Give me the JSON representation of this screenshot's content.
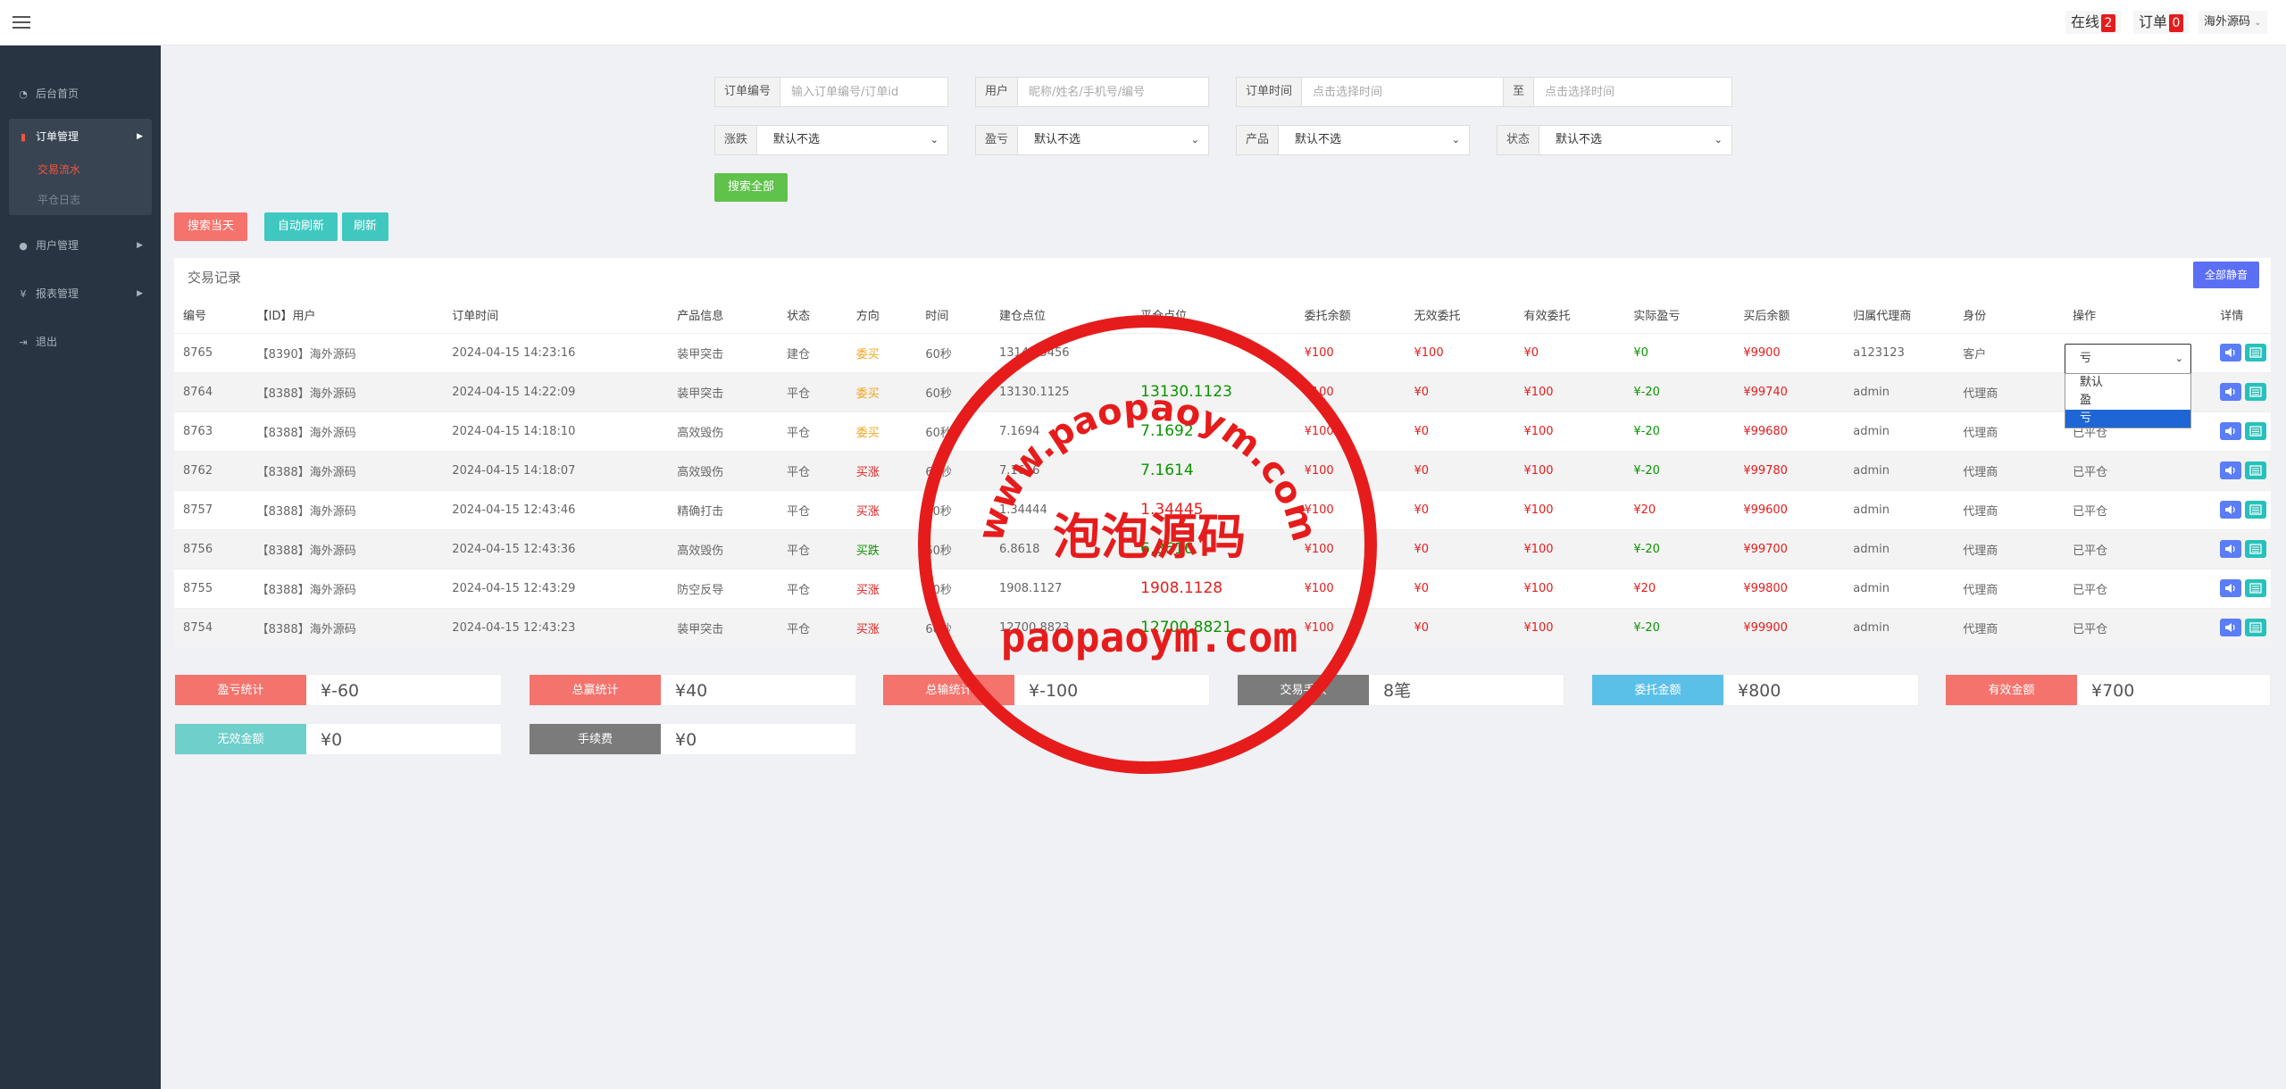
{
  "topbar": {
    "online_label": "在线",
    "online_count": "2",
    "orders_label": "订单",
    "orders_count": "0",
    "user_name": "海外源码",
    "user_caret": "⌄"
  },
  "sidebar": {
    "items": [
      {
        "label": "后台首页",
        "icon": "dashboard-icon"
      },
      {
        "label": "订单管理",
        "icon": "order-icon"
      },
      {
        "label": "用户管理",
        "icon": "user-icon"
      },
      {
        "label": "报表管理",
        "icon": "yen-icon"
      },
      {
        "label": "退出",
        "icon": "logout-icon"
      }
    ],
    "subitems": [
      {
        "label": "交易流水",
        "active": true
      },
      {
        "label": "平仓日志",
        "active": false
      }
    ]
  },
  "filters": {
    "order_no_label": "订单编号",
    "order_no_placeholder": "输入订单编号/订单id",
    "user_label": "用户",
    "user_placeholder": "昵称/姓名/手机号/编号",
    "time_label": "订单时间",
    "time_placeholder": "点击选择时间",
    "to_label": "至",
    "to_placeholder": "点击选择时间",
    "rise_label": "涨跌",
    "rise_value": "默认不选",
    "pnl_label": "盈亏",
    "pnl_value": "默认不选",
    "product_label": "产品",
    "product_value": "默认不选",
    "status_label": "状态",
    "status_value": "默认不选",
    "search_all": "搜索全部"
  },
  "actions": {
    "search_today": "搜索当天",
    "auto_refresh": "自动刷新",
    "refresh": "刷新",
    "mute_all": "全部静音"
  },
  "panel_title": "交易记录",
  "table": {
    "headers": [
      "编号",
      "【ID】用户",
      "订单时间",
      "产品信息",
      "状态",
      "方向",
      "时间",
      "建仓点位",
      "平仓点位",
      "委托余额",
      "无效委托",
      "有效委托",
      "实际盈亏",
      "买后余额",
      "归属代理商",
      "身份",
      "操作",
      "详情"
    ],
    "rows": [
      {
        "id": "8765",
        "user": "【8390】海外源码",
        "time": "2024-04-15 14:23:16",
        "product": "装甲突击",
        "status": "建仓",
        "dir": "委买",
        "dur": "60秒",
        "open": "13146.5456",
        "close": "",
        "amount": "¥100",
        "invalid": "¥100",
        "valid": "¥0",
        "pnl": "¥0",
        "balance": "¥9900",
        "agent": "a123123",
        "role": "客户",
        "op": ""
      },
      {
        "id": "8764",
        "user": "【8388】海外源码",
        "time": "2024-04-15 14:22:09",
        "product": "装甲突击",
        "status": "平仓",
        "dir": "委买",
        "dur": "60秒",
        "open": "13130.1125",
        "close": "13130.1123",
        "amount": "¥100",
        "invalid": "¥0",
        "valid": "¥100",
        "pnl": "¥-20",
        "balance": "¥99740",
        "agent": "admin",
        "role": "代理商",
        "op": ""
      },
      {
        "id": "8763",
        "user": "【8388】海外源码",
        "time": "2024-04-15 14:18:10",
        "product": "高效毁伤",
        "status": "平仓",
        "dir": "委买",
        "dur": "60秒",
        "open": "7.1694",
        "close": "7.1692",
        "amount": "¥100",
        "invalid": "¥0",
        "valid": "¥100",
        "pnl": "¥-20",
        "balance": "¥99680",
        "agent": "admin",
        "role": "代理商",
        "op": "已平仓"
      },
      {
        "id": "8762",
        "user": "【8388】海外源码",
        "time": "2024-04-15 14:18:07",
        "product": "高效毁伤",
        "status": "平仓",
        "dir": "买涨",
        "dur": "60秒",
        "open": "7.1616",
        "close": "7.1614",
        "amount": "¥100",
        "invalid": "¥0",
        "valid": "¥100",
        "pnl": "¥-20",
        "balance": "¥99780",
        "agent": "admin",
        "role": "代理商",
        "op": "已平仓"
      },
      {
        "id": "8757",
        "user": "【8388】海外源码",
        "time": "2024-04-15 12:43:46",
        "product": "精确打击",
        "status": "平仓",
        "dir": "买涨",
        "dur": "60秒",
        "open": "1.34444",
        "close": "1.34445",
        "amount": "¥100",
        "invalid": "¥0",
        "valid": "¥100",
        "pnl": "¥20",
        "balance": "¥99600",
        "agent": "admin",
        "role": "代理商",
        "op": "已平仓"
      },
      {
        "id": "8756",
        "user": "【8388】海外源码",
        "time": "2024-04-15 12:43:36",
        "product": "高效毁伤",
        "status": "平仓",
        "dir": "买跌",
        "dur": "60秒",
        "open": "6.8618",
        "close": "6.8616",
        "amount": "¥100",
        "invalid": "¥0",
        "valid": "¥100",
        "pnl": "¥-20",
        "balance": "¥99700",
        "agent": "admin",
        "role": "代理商",
        "op": "已平仓"
      },
      {
        "id": "8755",
        "user": "【8388】海外源码",
        "time": "2024-04-15 12:43:29",
        "product": "防空反导",
        "status": "平仓",
        "dir": "买涨",
        "dur": "60秒",
        "open": "1908.1127",
        "close": "1908.1128",
        "amount": "¥100",
        "invalid": "¥0",
        "valid": "¥100",
        "pnl": "¥20",
        "balance": "¥99800",
        "agent": "admin",
        "role": "代理商",
        "op": "已平仓"
      },
      {
        "id": "8754",
        "user": "【8388】海外源码",
        "time": "2024-04-15 12:43:23",
        "product": "装甲突击",
        "status": "平仓",
        "dir": "买涨",
        "dur": "60秒",
        "open": "12700.8823",
        "close": "12700.8821",
        "amount": "¥100",
        "invalid": "¥0",
        "valid": "¥100",
        "pnl": "¥-20",
        "balance": "¥99900",
        "agent": "admin",
        "role": "代理商",
        "op": "已平仓"
      }
    ]
  },
  "dropdown": {
    "selected": "亏",
    "options": [
      "默认",
      "盈",
      "亏"
    ]
  },
  "stats": [
    {
      "label": "盈亏统计",
      "value": "¥-60",
      "color": "#f4736d"
    },
    {
      "label": "总赢统计",
      "value": "¥40",
      "color": "#f4736d"
    },
    {
      "label": "总输统计",
      "value": "¥-100",
      "color": "#f4736d"
    },
    {
      "label": "交易手数",
      "value": "8笔",
      "color": "#7b7b7b"
    },
    {
      "label": "委托金额",
      "value": "¥800",
      "color": "#5bc0e8"
    },
    {
      "label": "有效金额",
      "value": "¥700",
      "color": "#f4736d"
    },
    {
      "label": "无效金额",
      "value": "¥0",
      "color": "#6ecfcb"
    },
    {
      "label": "手续费",
      "value": "¥0",
      "color": "#7b7b7b"
    }
  ],
  "watermark": {
    "top_text": "www.paopaoym.com",
    "center_text": "泡泡源码",
    "bottom_text": "paopaoym.com"
  }
}
